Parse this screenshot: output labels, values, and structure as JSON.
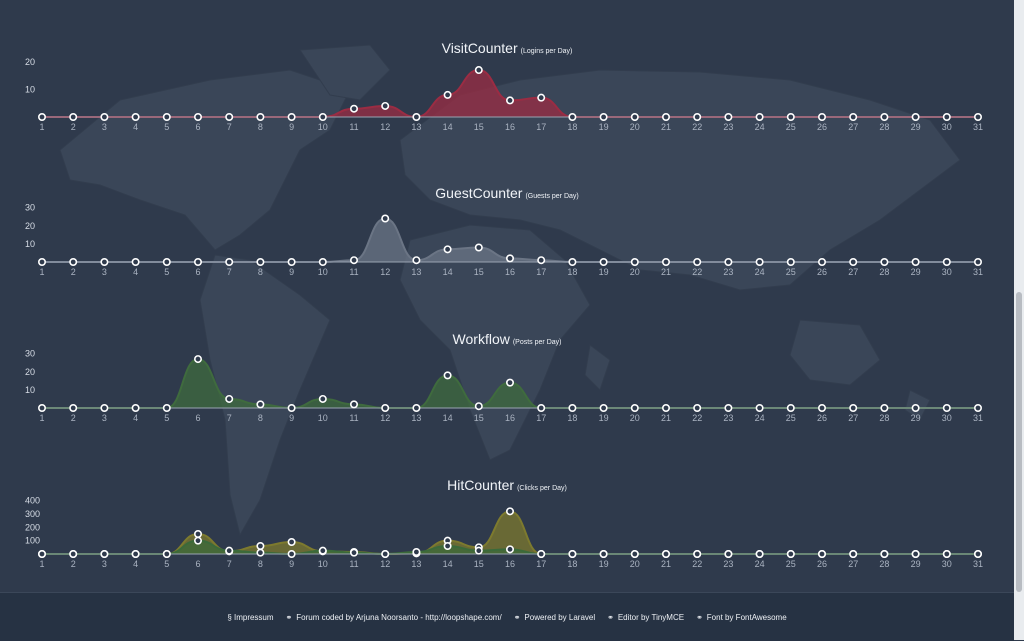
{
  "footer": {
    "impressum": "§ Impressum",
    "forum": "Forum coded by Arjuna Noorsanto - http://loopshape.com/",
    "laravel": "Powered by Laravel",
    "editor": "Editor by TinyMCE",
    "font": "Font by FontAwesome"
  },
  "chart_data": [
    {
      "type": "area",
      "title": "VisitCounter",
      "subtitle": "(Logins per Day)",
      "x": [
        1,
        2,
        3,
        4,
        5,
        6,
        7,
        8,
        9,
        10,
        11,
        12,
        13,
        14,
        15,
        16,
        17,
        18,
        19,
        20,
        21,
        22,
        23,
        24,
        25,
        26,
        27,
        28,
        29,
        30,
        31
      ],
      "yticks": [
        10,
        20
      ],
      "ylim": [
        0,
        21
      ],
      "series": [
        {
          "values": [
            0,
            0,
            0,
            0,
            0,
            0,
            0,
            0,
            0,
            0,
            3,
            4,
            0,
            8,
            17,
            6,
            7,
            0,
            0,
            0,
            0,
            0,
            0,
            0,
            0,
            0,
            0,
            0,
            0,
            0,
            0
          ],
          "color": "#9b2c43"
        }
      ],
      "grid": false
    },
    {
      "type": "area",
      "title": "GuestCounter",
      "subtitle": "(Guests per Day)",
      "x": [
        1,
        2,
        3,
        4,
        5,
        6,
        7,
        8,
        9,
        10,
        11,
        12,
        13,
        14,
        15,
        16,
        17,
        18,
        19,
        20,
        21,
        22,
        23,
        24,
        25,
        26,
        27,
        28,
        29,
        30,
        31
      ],
      "yticks": [
        10,
        20,
        30
      ],
      "ylim": [
        0,
        32
      ],
      "series": [
        {
          "values": [
            0,
            0,
            0,
            0,
            0,
            0,
            0,
            0,
            0,
            0,
            1,
            24,
            1,
            7,
            8,
            2,
            1,
            0,
            0,
            0,
            0,
            0,
            0,
            0,
            0,
            0,
            0,
            0,
            0,
            0,
            0
          ],
          "color": "#6b7585"
        }
      ],
      "grid": false
    },
    {
      "type": "area",
      "title": "Workflow",
      "subtitle": "(Posts per Day)",
      "x": [
        1,
        2,
        3,
        4,
        5,
        6,
        7,
        8,
        9,
        10,
        11,
        12,
        13,
        14,
        15,
        16,
        17,
        18,
        19,
        20,
        21,
        22,
        23,
        24,
        25,
        26,
        27,
        28,
        29,
        30,
        31
      ],
      "yticks": [
        10,
        20,
        30
      ],
      "ylim": [
        0,
        32
      ],
      "series": [
        {
          "values": [
            0,
            0,
            0,
            0,
            0,
            27,
            5,
            2,
            0,
            5,
            2,
            0,
            0,
            18,
            1,
            14,
            0,
            0,
            0,
            0,
            0,
            0,
            0,
            0,
            0,
            0,
            0,
            0,
            0,
            0,
            0
          ],
          "color": "#3f6b3e"
        }
      ],
      "grid": false
    },
    {
      "type": "area",
      "title": "HitCounter",
      "subtitle": "(Clicks per Day)",
      "x": [
        1,
        2,
        3,
        4,
        5,
        6,
        7,
        8,
        9,
        10,
        11,
        12,
        13,
        14,
        15,
        16,
        17,
        18,
        19,
        20,
        21,
        22,
        23,
        24,
        25,
        26,
        27,
        28,
        29,
        30,
        31
      ],
      "yticks": [
        100,
        200,
        300,
        400
      ],
      "ylim": [
        0,
        420
      ],
      "series": [
        {
          "values": [
            0,
            0,
            0,
            0,
            0,
            150,
            20,
            60,
            90,
            20,
            15,
            0,
            5,
            100,
            50,
            320,
            0,
            0,
            0,
            0,
            0,
            0,
            0,
            0,
            0,
            0,
            0,
            0,
            0,
            0,
            0
          ],
          "color": "#7d7a2e"
        },
        {
          "values": [
            0,
            0,
            0,
            0,
            0,
            100,
            25,
            10,
            0,
            25,
            10,
            0,
            15,
            60,
            25,
            35,
            0,
            0,
            0,
            0,
            0,
            0,
            0,
            0,
            0,
            0,
            0,
            0,
            0,
            0,
            0
          ],
          "color": "#3b6a3a"
        }
      ],
      "grid": false
    }
  ]
}
